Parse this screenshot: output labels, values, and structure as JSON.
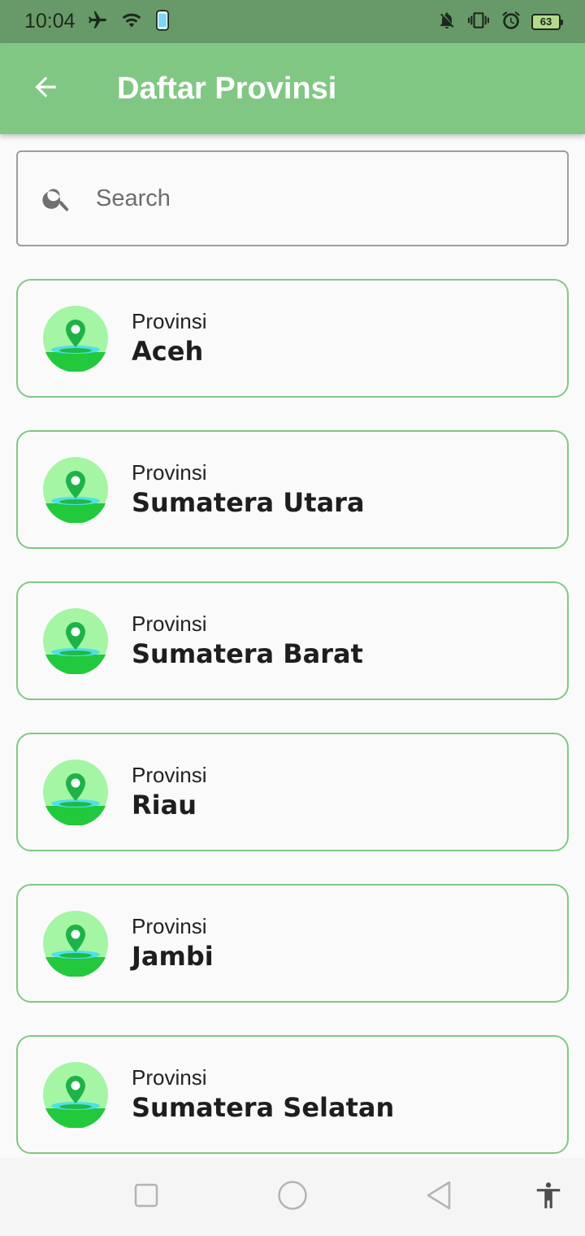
{
  "status_bar": {
    "time": "10:04",
    "battery": "63"
  },
  "app_bar": {
    "title": "Daftar Provinsi"
  },
  "search": {
    "placeholder": "Search",
    "value": ""
  },
  "provinces": [
    {
      "caption": "Provinsi",
      "name": "Aceh"
    },
    {
      "caption": "Provinsi",
      "name": "Sumatera Utara"
    },
    {
      "caption": "Provinsi",
      "name": "Sumatera Barat"
    },
    {
      "caption": "Provinsi",
      "name": "Riau"
    },
    {
      "caption": "Provinsi",
      "name": "Jambi"
    },
    {
      "caption": "Provinsi",
      "name": "Sumatera Selatan"
    }
  ],
  "colors": {
    "app_bar": "#81c784",
    "status_bar": "#689a69",
    "card_border": "#81c784"
  },
  "icons": {
    "back": "arrow-left-icon",
    "search": "search-icon",
    "avatar": "map-pin-icon",
    "nav_recent": "square-icon",
    "nav_home": "circle-icon",
    "nav_back": "triangle-back-icon",
    "accessibility": "accessibility-icon"
  }
}
